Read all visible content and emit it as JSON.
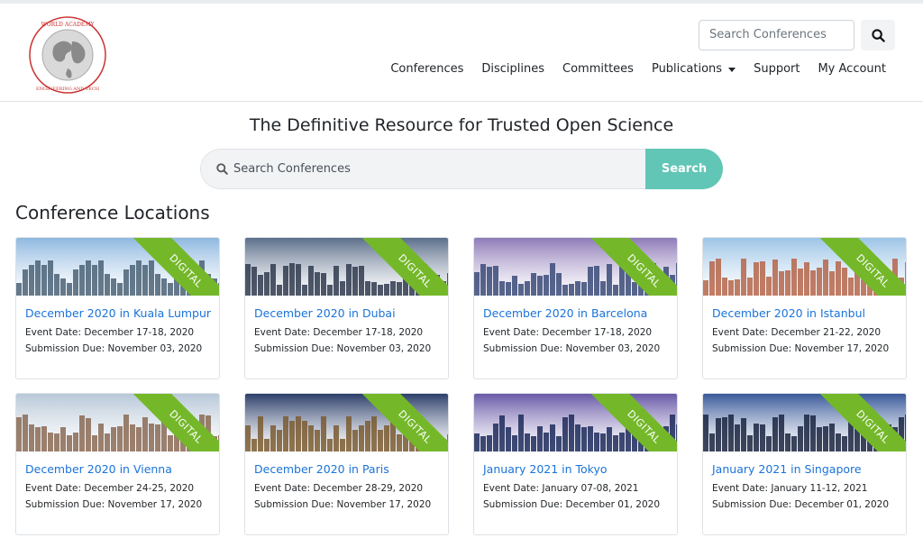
{
  "brand": {
    "logo_text": "World Academy of Science, Engineering and Technology"
  },
  "header": {
    "search_placeholder": "Search Conferences",
    "nav": [
      {
        "label": "Conferences"
      },
      {
        "label": "Disciplines"
      },
      {
        "label": "Committees"
      },
      {
        "label": "Publications",
        "dropdown": true
      },
      {
        "label": "Support"
      },
      {
        "label": "My Account"
      }
    ]
  },
  "hero": {
    "title": "The Definitive Resource for Trusted Open Science",
    "search_placeholder": "Search Conferences",
    "search_button": "Search"
  },
  "locations": {
    "heading": "Conference Locations",
    "ribbon_label": "DIGITAL",
    "cards": [
      {
        "title": "December 2020 in Kuala Lumpur",
        "event": "Event Date: December 17-18, 2020",
        "due": "Submission Due: November 03, 2020",
        "sky": "#8fb8e0",
        "ground": "#4a6275"
      },
      {
        "title": "December 2020 in Dubai",
        "event": "Event Date: December 17-18, 2020",
        "due": "Submission Due: November 03, 2020",
        "sky": "#5b6f8a",
        "ground": "#2f3a4e"
      },
      {
        "title": "December 2020 in Barcelona",
        "event": "Event Date: December 17-18, 2020",
        "due": "Submission Due: November 03, 2020",
        "sky": "#8e7bb8",
        "ground": "#3a4a78"
      },
      {
        "title": "December 2020 in Istanbul",
        "event": "Event Date: December 21-22, 2020",
        "due": "Submission Due: November 17, 2020",
        "sky": "#9cc4e6",
        "ground": "#b5654a"
      },
      {
        "title": "December 2020 in Vienna",
        "event": "Event Date: December 24-25, 2020",
        "due": "Submission Due: November 17, 2020",
        "sky": "#b8c8d8",
        "ground": "#8a6a55"
      },
      {
        "title": "December 2020 in Paris",
        "event": "Event Date: December 28-29, 2020",
        "due": "Submission Due: November 17, 2020",
        "sky": "#2c3f6a",
        "ground": "#7a5a30"
      },
      {
        "title": "January 2021 in Tokyo",
        "event": "Event Date: January 07-08, 2021",
        "due": "Submission Due: December 01, 2020",
        "sky": "#6a5aa8",
        "ground": "#1c2a5a"
      },
      {
        "title": "January 2021 in Singapore",
        "event": "Event Date: January 11-12, 2021",
        "due": "Submission Due: December 01, 2020",
        "sky": "#3a5a9a",
        "ground": "#1a2540"
      }
    ]
  },
  "colors": {
    "accent": "#62c6b6",
    "ribbon": "#74b82a",
    "link": "#1a73d9"
  }
}
